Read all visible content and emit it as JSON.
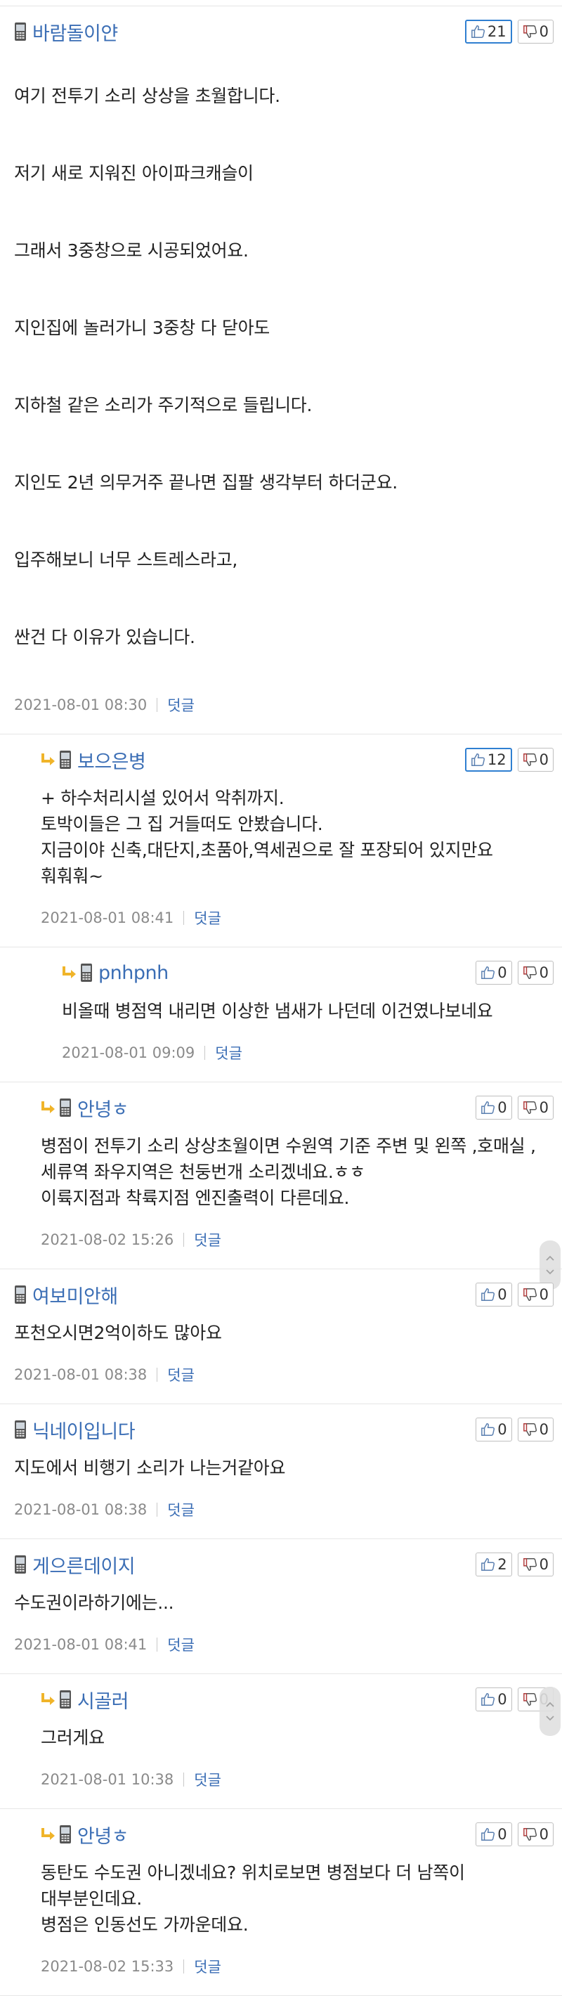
{
  "comments": [
    {
      "id": "c1",
      "level": 0,
      "nick": "바람돌이얀",
      "up": "21",
      "down": "0",
      "up_active": true,
      "lines": [
        "여기 전투기 소리 상상을 초월합니다.",
        "저기 새로 지워진 아이파크캐슬이",
        "그래서 3중창으로 시공되었어요.",
        "지인집에 놀러가니 3중창 다 닫아도",
        "지하철 같은 소리가 주기적으로 들립니다.",
        "지인도 2년 의무거주 끝나면 집팔 생각부터 하더군요.",
        "입주해보니 너무 스트레스라고,",
        "싼건 다 이유가 있습니다."
      ],
      "time": "2021-08-01 08:30",
      "reply_label": "덧글"
    },
    {
      "id": "c2",
      "level": 1,
      "nick": "보으은병",
      "up": "12",
      "down": "0",
      "up_active": true,
      "text": "+ 하수처리시설 있어서 악취까지.\n토박이들은 그 집 거들떠도 안봤습니다.\n지금이야 신축,대단지,초품아,역세권으로 잘 포장되어 있지만요\n훠훠훠~",
      "time": "2021-08-01 08:41",
      "reply_label": "덧글"
    },
    {
      "id": "c3",
      "level": 2,
      "nick": "pnhpnh",
      "up": "0",
      "down": "0",
      "up_active": false,
      "text": "비올때 병점역 내리면 이상한 냄새가 나던데 이건였나보네요",
      "time": "2021-08-01 09:09",
      "reply_label": "덧글"
    },
    {
      "id": "c4",
      "level": 1,
      "nick": "안녕ㅎ",
      "up": "0",
      "down": "0",
      "up_active": false,
      "text": "병점이 전투기 소리 상상초월이면 수원역 기준 주변 및 왼쪽 ,호매실 , 세류역 좌우지역은 천둥번개 소리겠네요.ㅎㅎ\n이륙지점과 착륙지점  엔진출력이 다른데요.",
      "time": "2021-08-02 15:26",
      "reply_label": "덧글"
    },
    {
      "id": "c5",
      "level": 0,
      "nick": "여보미안해",
      "up": "0",
      "down": "0",
      "up_active": false,
      "text": "포천오시면2억이하도 많아요",
      "time": "2021-08-01 08:38",
      "reply_label": "덧글"
    },
    {
      "id": "c6",
      "level": 0,
      "nick": "닉네이입니다",
      "up": "0",
      "down": "0",
      "up_active": false,
      "text": "지도에서 비행기 소리가 나는거같아요",
      "time": "2021-08-01 08:38",
      "reply_label": "덧글"
    },
    {
      "id": "c7",
      "level": 0,
      "nick": "게으른데이지",
      "up": "2",
      "down": "0",
      "up_active": false,
      "text": "수도권이라하기에는...",
      "time": "2021-08-01 08:41",
      "reply_label": "덧글"
    },
    {
      "id": "c8",
      "level": 1,
      "nick": "시골러",
      "up": "0",
      "down": "0",
      "up_active": false,
      "text": "그러게요",
      "time": "2021-08-01 10:38",
      "reply_label": "덧글"
    },
    {
      "id": "c9",
      "level": 1,
      "nick": "안녕ㅎ",
      "up": "0",
      "down": "0",
      "up_active": false,
      "text": "동탄도 수도권 아니겠네요? 위치로보면 병점보다 더 남쪽이 대부분인데요.\n병점은 인동선도 가까운데요.",
      "time": "2021-08-02 15:33",
      "reply_label": "덧글"
    }
  ],
  "colors": {
    "nick": "#3b6eb5",
    "active_border": "#2f7fd1",
    "reply_arrow": "#f0b429"
  }
}
